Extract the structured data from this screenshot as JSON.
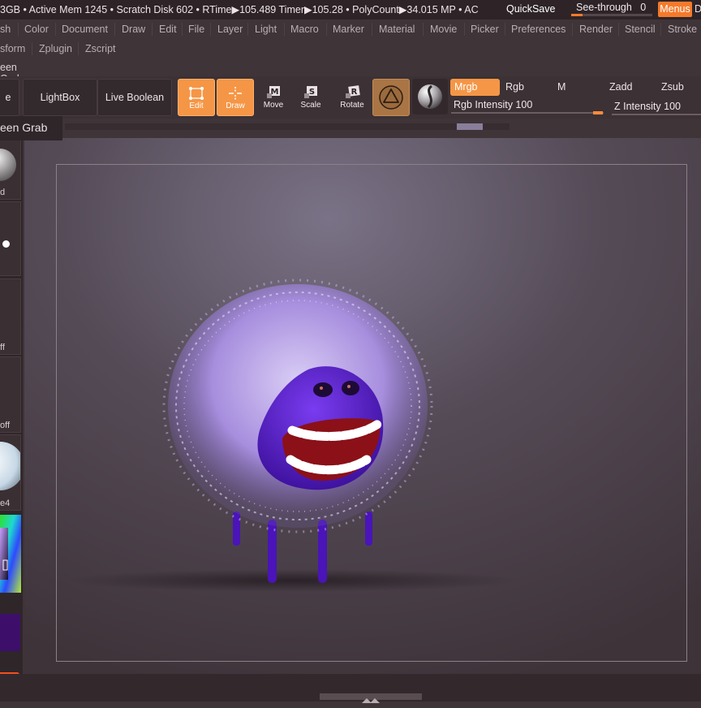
{
  "app": {
    "name": "ZBrush"
  },
  "status_bar": {
    "text": "3GB • Active Mem 1245 • Scratch Disk 602 • RTime▶105.489 Timer▶105.28 • PolyCount▶34.015 MP • AC",
    "quicksave_label": "QuickSave",
    "see_through_label": "See-through",
    "see_through_value": "0",
    "see_through_level": 0.0,
    "menus_label": "Menus",
    "trailing_char": "D"
  },
  "main_menu": {
    "items": [
      "sh",
      "Color",
      "Document",
      "Draw",
      "Edit",
      "File",
      "Layer",
      "Light",
      "Macro",
      "Marker",
      "Material",
      "Movie",
      "Picker",
      "Preferences",
      "Render",
      "Stencil",
      "Stroke"
    ]
  },
  "sub_menu": {
    "items": [
      "sform",
      "Zplugin",
      "Zscript"
    ]
  },
  "palette_title": "een Grab",
  "toolbar": {
    "left_button_partial": "e",
    "lightbox_label": "LightBox",
    "live_boolean_label": "Live Boolean",
    "tools": [
      {
        "label": "Edit",
        "icon": "edit-icon",
        "active": true
      },
      {
        "label": "Draw",
        "icon": "draw-icon",
        "active": true
      },
      {
        "label": "Move",
        "icon": "move-icon",
        "active": false
      },
      {
        "label": "Scale",
        "icon": "scale-icon",
        "active": false
      },
      {
        "label": "Rotate",
        "icon": "rotate-icon",
        "active": false
      }
    ],
    "material_icon": "material-icon",
    "sphere_icon": "spotlight-sphere-icon",
    "channels": {
      "mrgb": "Mrgb",
      "rgb": "Rgb",
      "m": "M",
      "zadd": "Zadd",
      "zsub": "Zsub",
      "rgb_intensity_label": "Rgb Intensity 100",
      "z_intensity_label": "Z Intensity 100"
    }
  },
  "screen_grab_label": "een Grab",
  "left_panel": {
    "labels": [
      "d",
      "ff",
      "off",
      "e4"
    ]
  },
  "colors": {
    "accent": "#f59646",
    "menus_button": "#f47a2b",
    "canvas_background": "#4b4047",
    "creature_body": "#5a1fc8",
    "fur": "#b9a2e6"
  }
}
